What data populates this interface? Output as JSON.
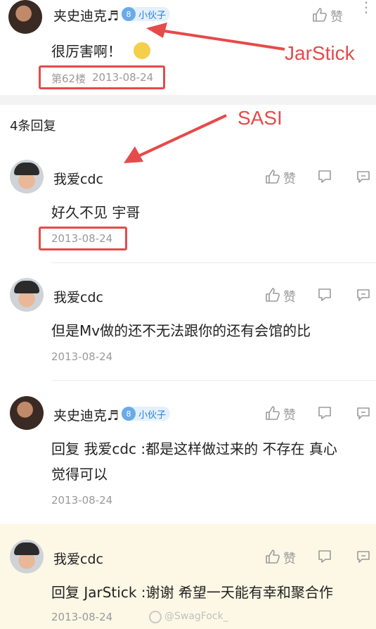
{
  "main_post": {
    "username": "夹史迪克♬",
    "level": "8",
    "level_title": "小伙子",
    "text": "很厉害啊！",
    "floor": "第62楼",
    "date": "2013-08-24",
    "like_label": "赞"
  },
  "annotations": {
    "top": "JarStick",
    "middle": "SASI"
  },
  "replies_header": "4条回复",
  "replies": [
    {
      "username": "我爱cdc",
      "text": "好久不见 宇哥",
      "date": "2013-08-24",
      "like_label": "赞"
    },
    {
      "username": "我爱cdc",
      "text": "但是Mv做的还不无法跟你的还有会馆的比",
      "date": "2013-08-24",
      "like_label": "赞"
    },
    {
      "username": "夹史迪克♬",
      "level": "8",
      "level_title": "小伙子",
      "text_line1": "回复 我爱cdc :都是这样做过来的 不存在 真心",
      "text_line2": "觉得可以",
      "date": "2013-08-24",
      "like_label": "赞"
    },
    {
      "username": "我爱cdc",
      "text": "回复 JarStick :谢谢 希望一天能有幸和聚合作",
      "date": "2013-08-24",
      "like_label": "赞"
    }
  ],
  "watermark": "@SwagFock_",
  "colors": {
    "accent_red": "#e64a4a",
    "highlight_bg": "#fdf8e6",
    "meta_gray": "#9a9a9a"
  }
}
